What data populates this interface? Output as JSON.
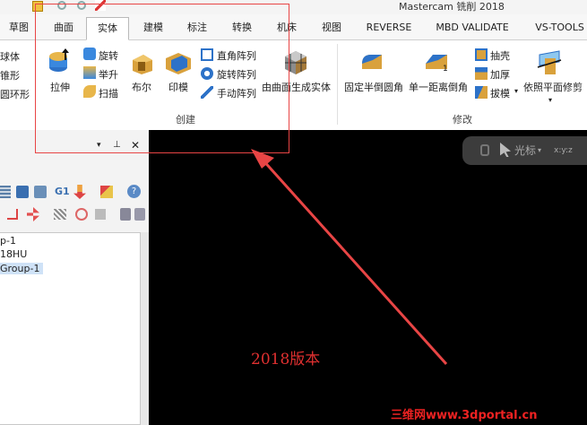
{
  "window": {
    "title": "Mastercam 铣削 2018"
  },
  "tabs": [
    "草图",
    "曲面",
    "实体",
    "建模",
    "标注",
    "转换",
    "机床",
    "视图",
    "REVERSE",
    "MBD VALIDATE",
    "VS-TOOLS"
  ],
  "active_tab": "实体",
  "ribbon": {
    "left_partial": [
      "球体",
      "锥形",
      "圆环形"
    ],
    "create": {
      "extrude": "拉伸",
      "revolve": "旋转",
      "loft": "举升",
      "sweep": "扫描",
      "boolean": "布尔",
      "imprint": "印模",
      "rect_pattern": "直角阵列",
      "rot_pattern": "旋转阵列",
      "manual_pattern": "手动阵列",
      "group_label": "创建"
    },
    "surface_to_solid": "由曲面生成实体",
    "modify": {
      "const_fillet": "固定半倒圆角",
      "one_dist_chamfer": "单一距离倒角",
      "shell": "抽壳",
      "thicken": "加厚",
      "draft": "拔模",
      "trim_plane": "依照平面修剪",
      "group_label": "修改"
    }
  },
  "panel": {
    "header_icons": [
      "chevron-down-icon",
      "pin-icon",
      "close-icon"
    ],
    "toolbar_g1": "G1",
    "tree": [
      "p-1",
      "18HU",
      "Group-1"
    ]
  },
  "viewport": {
    "selector_label": "光标",
    "coord_label": "x:y:z"
  },
  "annotation": {
    "caption": "2018版本",
    "watermark": "三维网www.3dportal.cn",
    "color": "#e84545"
  }
}
